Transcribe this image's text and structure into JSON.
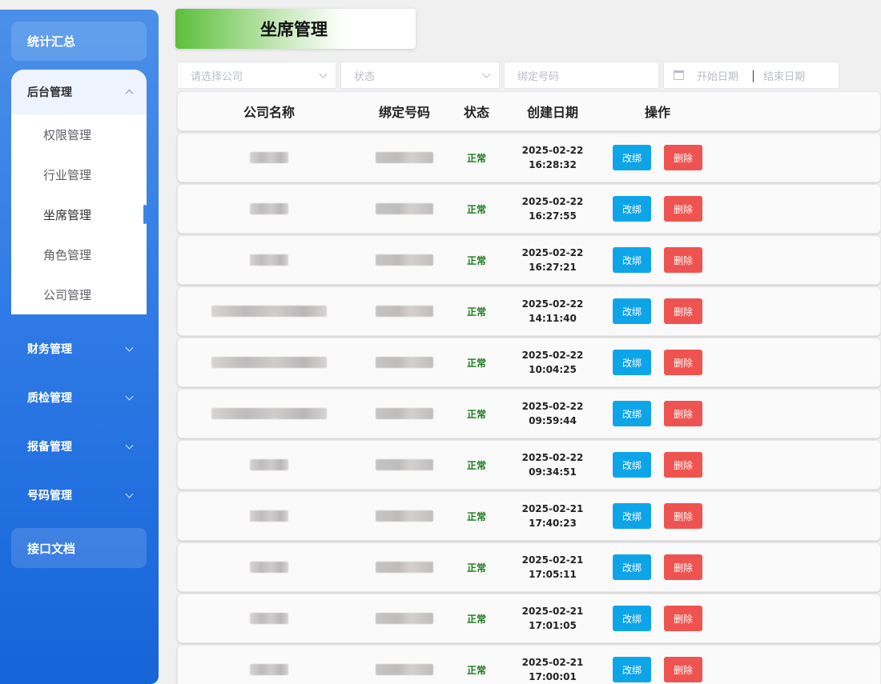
{
  "sidebar": {
    "summary_label": "统计汇总",
    "backend_group": {
      "label": "后台管理",
      "items": [
        {
          "label": "权限管理",
          "active": false
        },
        {
          "label": "行业管理",
          "active": false
        },
        {
          "label": "坐席管理",
          "active": true
        },
        {
          "label": "角色管理",
          "active": false
        },
        {
          "label": "公司管理",
          "active": false
        }
      ]
    },
    "collapsed_groups": [
      {
        "label": "财务管理"
      },
      {
        "label": "质检管理"
      },
      {
        "label": "报备管理"
      },
      {
        "label": "号码管理"
      }
    ],
    "api_docs_label": "接口文档"
  },
  "header": {
    "title": "坐席管理"
  },
  "filters": {
    "company_placeholder": "请选择公司",
    "status_placeholder": "状态",
    "number_placeholder": "绑定号码",
    "start_date_placeholder": "开始日期",
    "date_separator": "|",
    "end_date_placeholder": "结束日期"
  },
  "table": {
    "columns": {
      "company": "公司名称",
      "number": "绑定号码",
      "status": "状态",
      "created": "创建日期",
      "ops": "操作"
    },
    "rows": [
      {
        "status": "正常",
        "date": "2025-02-22",
        "time": "16:28:32",
        "rebind": "改绑",
        "delete": "删除",
        "company_width": "short"
      },
      {
        "status": "正常",
        "date": "2025-02-22",
        "time": "16:27:55",
        "rebind": "改绑",
        "delete": "删除",
        "company_width": "short"
      },
      {
        "status": "正常",
        "date": "2025-02-22",
        "time": "16:27:21",
        "rebind": "改绑",
        "delete": "删除",
        "company_width": "short"
      },
      {
        "status": "正常",
        "date": "2025-02-22",
        "time": "14:11:40",
        "rebind": "改绑",
        "delete": "删除",
        "company_width": "long"
      },
      {
        "status": "正常",
        "date": "2025-02-22",
        "time": "10:04:25",
        "rebind": "改绑",
        "delete": "删除",
        "company_width": "long"
      },
      {
        "status": "正常",
        "date": "2025-02-22",
        "time": "09:59:44",
        "rebind": "改绑",
        "delete": "删除",
        "company_width": "long"
      },
      {
        "status": "正常",
        "date": "2025-02-22",
        "time": "09:34:51",
        "rebind": "改绑",
        "delete": "删除",
        "company_width": "short"
      },
      {
        "status": "正常",
        "date": "2025-02-21",
        "time": "17:40:23",
        "rebind": "改绑",
        "delete": "删除",
        "company_width": "short"
      },
      {
        "status": "正常",
        "date": "2025-02-21",
        "time": "17:05:11",
        "rebind": "改绑",
        "delete": "删除",
        "company_width": "short"
      },
      {
        "status": "正常",
        "date": "2025-02-21",
        "time": "17:01:05",
        "rebind": "改绑",
        "delete": "删除",
        "company_width": "short"
      },
      {
        "status": "正常",
        "date": "2025-02-21",
        "time": "17:00:01",
        "rebind": "改绑",
        "delete": "删除",
        "company_width": "short"
      }
    ]
  },
  "colors": {
    "sidebar_top": "#4a90e8",
    "sidebar_bottom": "#1565d8",
    "title_green": "#5cbf3a",
    "status_green": "#1a7a1a",
    "rebind_button": "#0ea4e8",
    "delete_button": "#ef5350"
  }
}
